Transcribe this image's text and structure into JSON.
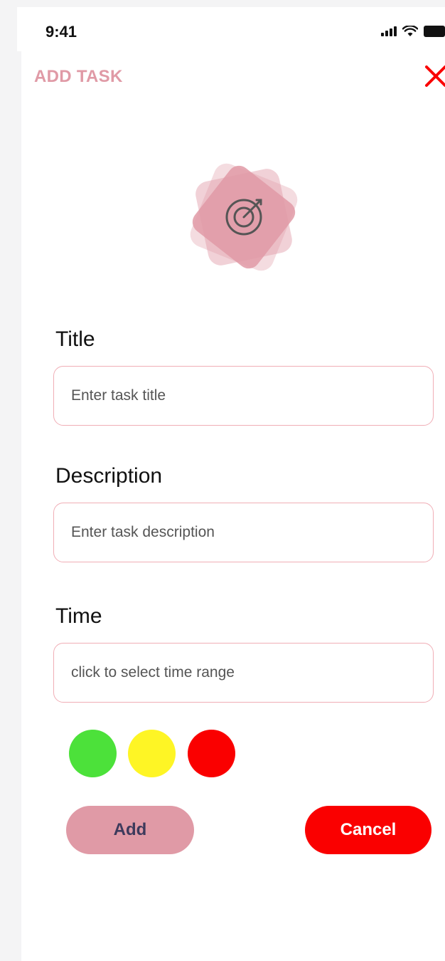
{
  "status_bar": {
    "time": "9:41",
    "signal_icon": "cellular-signal-icon",
    "wifi_icon": "wifi-icon",
    "battery_icon": "battery-icon"
  },
  "header": {
    "title": "ADD TASK",
    "close_icon": "close-icon"
  },
  "logo": {
    "icon": "target-icon"
  },
  "form": {
    "title_label": "Title",
    "title_placeholder": "Enter task title",
    "description_label": "Description",
    "description_placeholder": "Enter task description",
    "time_label": "Time",
    "time_placeholder": "click to select time range"
  },
  "priority_colors": [
    "#4ce13a",
    "#fef525",
    "#fa0000"
  ],
  "buttons": {
    "add_label": "Add",
    "cancel_label": "Cancel"
  },
  "colors": {
    "accent_pink": "#e09aa6",
    "input_border": "#f0aeb6",
    "cancel_red": "#fa0000",
    "add_text": "#3d3a5c"
  }
}
